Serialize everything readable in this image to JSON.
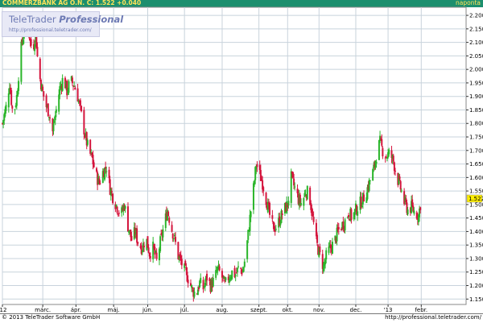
{
  "header": {
    "title": "COMMERZBANK AG O.N.  C: 1.522 +0.040",
    "period": "naponta"
  },
  "watermark": {
    "brand_plain": "TeleTrader ",
    "brand_bold": "Professional",
    "url": "http://professional.teletrader.com/"
  },
  "footer": {
    "copyright": "© 2013 TeleTrader Software GmbH",
    "url": "http://professional.teletrader.com/"
  },
  "colors": {
    "up": "#2ab52a",
    "down": "#d4143c",
    "grid": "#c8d3dc",
    "header_bg": "#1c8f6e",
    "header_text": "#ffe35a",
    "last_price_tag": "#ffef00"
  },
  "chart_data": {
    "type": "candlestick",
    "last_price": "1.522",
    "change": "+0.040",
    "ylim": [
      1.13,
      2.23
    ],
    "yticks": [
      "2.200",
      "2.150",
      "2.100",
      "2.050",
      "2.000",
      "1.950",
      "1.900",
      "1.850",
      "1.800",
      "1.750",
      "1.700",
      "1.650",
      "1.600",
      "1.550",
      "1.500",
      "1.450",
      "1.400",
      "1.350",
      "1.300",
      "1.250",
      "1.200",
      "1.150"
    ],
    "xticks": [
      "'12",
      "márc.",
      "ápr.",
      "máj.",
      "jún.",
      "júl.",
      "aug.",
      "szept.",
      "okt.",
      "nov.",
      "dec.",
      "'13",
      "febr."
    ],
    "xtick_days": [
      0,
      45,
      82,
      124,
      162,
      203,
      245,
      286,
      318,
      353,
      394,
      430,
      467
    ],
    "day_range": [
      0,
      517
    ],
    "anchors": [
      [
        0,
        1.8
      ],
      [
        4,
        1.86
      ],
      [
        8,
        1.95
      ],
      [
        12,
        1.82
      ],
      [
        16,
        1.9
      ],
      [
        20,
        2.06
      ],
      [
        24,
        2.14
      ],
      [
        28,
        2.18
      ],
      [
        31,
        2.1
      ],
      [
        34,
        2.07
      ],
      [
        37,
        2.14
      ],
      [
        40,
        2.0
      ],
      [
        44,
        1.93
      ],
      [
        48,
        1.87
      ],
      [
        52,
        1.84
      ],
      [
        56,
        1.77
      ],
      [
        60,
        1.85
      ],
      [
        64,
        1.93
      ],
      [
        68,
        1.97
      ],
      [
        72,
        1.92
      ],
      [
        76,
        1.96
      ],
      [
        80,
        1.94
      ],
      [
        84,
        1.9
      ],
      [
        88,
        1.83
      ],
      [
        92,
        1.76
      ],
      [
        96,
        1.7
      ],
      [
        100,
        1.67
      ],
      [
        104,
        1.61
      ],
      [
        108,
        1.58
      ],
      [
        112,
        1.62
      ],
      [
        116,
        1.64
      ],
      [
        120,
        1.56
      ],
      [
        124,
        1.52
      ],
      [
        128,
        1.49
      ],
      [
        132,
        1.46
      ],
      [
        136,
        1.5
      ],
      [
        140,
        1.42
      ],
      [
        144,
        1.37
      ],
      [
        148,
        1.4
      ],
      [
        152,
        1.35
      ],
      [
        156,
        1.34
      ],
      [
        160,
        1.38
      ],
      [
        164,
        1.32
      ],
      [
        168,
        1.34
      ],
      [
        172,
        1.29
      ],
      [
        176,
        1.36
      ],
      [
        180,
        1.42
      ],
      [
        184,
        1.48
      ],
      [
        188,
        1.42
      ],
      [
        192,
        1.37
      ],
      [
        196,
        1.31
      ],
      [
        200,
        1.28
      ],
      [
        204,
        1.25
      ],
      [
        208,
        1.22
      ],
      [
        212,
        1.18
      ],
      [
        216,
        1.17
      ],
      [
        220,
        1.21
      ],
      [
        224,
        1.19
      ],
      [
        228,
        1.23
      ],
      [
        232,
        1.2
      ],
      [
        236,
        1.22
      ],
      [
        240,
        1.26
      ],
      [
        244,
        1.24
      ],
      [
        248,
        1.2
      ],
      [
        252,
        1.23
      ],
      [
        256,
        1.25
      ],
      [
        260,
        1.24
      ],
      [
        264,
        1.27
      ],
      [
        268,
        1.25
      ],
      [
        272,
        1.33
      ],
      [
        276,
        1.45
      ],
      [
        280,
        1.56
      ],
      [
        283,
        1.65
      ],
      [
        286,
        1.62
      ],
      [
        290,
        1.58
      ],
      [
        294,
        1.52
      ],
      [
        298,
        1.46
      ],
      [
        302,
        1.41
      ],
      [
        306,
        1.42
      ],
      [
        310,
        1.45
      ],
      [
        314,
        1.48
      ],
      [
        318,
        1.5
      ],
      [
        322,
        1.6
      ],
      [
        326,
        1.56
      ],
      [
        330,
        1.52
      ],
      [
        334,
        1.5
      ],
      [
        338,
        1.55
      ],
      [
        342,
        1.54
      ],
      [
        346,
        1.45
      ],
      [
        350,
        1.36
      ],
      [
        354,
        1.31
      ],
      [
        358,
        1.27
      ],
      [
        362,
        1.32
      ],
      [
        366,
        1.34
      ],
      [
        370,
        1.36
      ],
      [
        374,
        1.4
      ],
      [
        378,
        1.42
      ],
      [
        382,
        1.44
      ],
      [
        386,
        1.47
      ],
      [
        390,
        1.45
      ],
      [
        394,
        1.48
      ],
      [
        398,
        1.5
      ],
      [
        402,
        1.52
      ],
      [
        406,
        1.55
      ],
      [
        410,
        1.59
      ],
      [
        414,
        1.63
      ],
      [
        418,
        1.7
      ],
      [
        421,
        1.73
      ],
      [
        424,
        1.7
      ],
      [
        428,
        1.68
      ],
      [
        432,
        1.69
      ],
      [
        436,
        1.66
      ],
      [
        440,
        1.6
      ],
      [
        444,
        1.56
      ],
      [
        448,
        1.51
      ],
      [
        452,
        1.48
      ],
      [
        456,
        1.49
      ],
      [
        460,
        1.47
      ],
      [
        464,
        1.46
      ],
      [
        467,
        1.522
      ]
    ]
  }
}
